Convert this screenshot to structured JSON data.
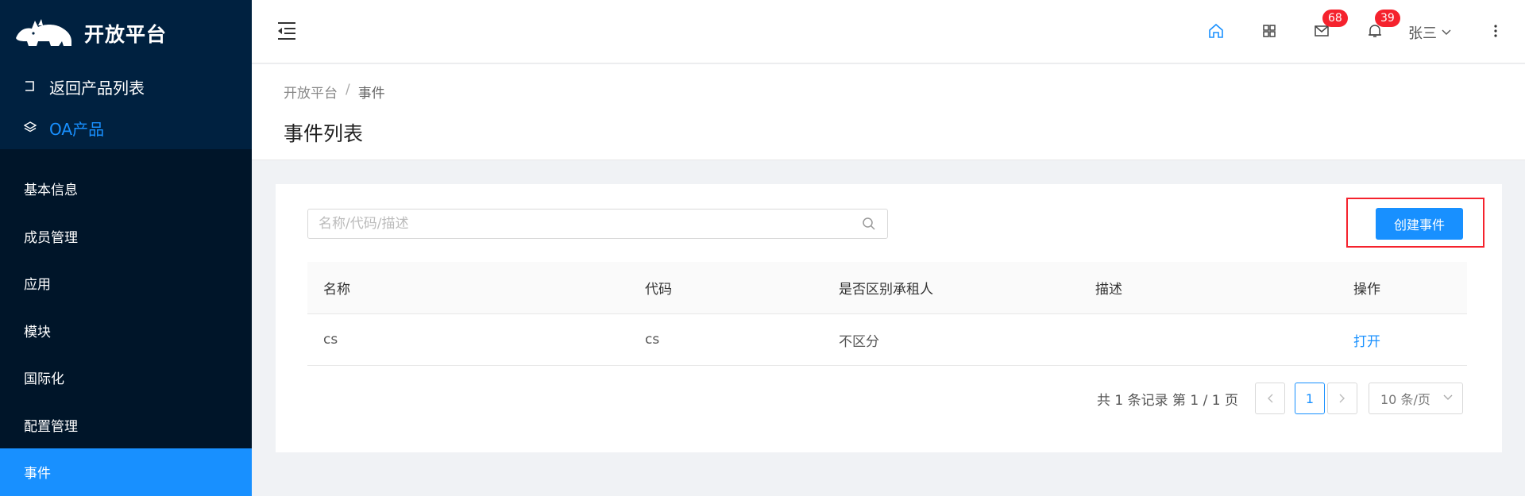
{
  "sidebar": {
    "logo_text": "开放平台",
    "back_label": "返回产品列表",
    "product_label": "OA产品",
    "items": [
      {
        "label": "基本信息"
      },
      {
        "label": "成员管理"
      },
      {
        "label": "应用"
      },
      {
        "label": "模块"
      },
      {
        "label": "国际化"
      },
      {
        "label": "配置管理"
      },
      {
        "label": "事件",
        "active": true
      }
    ]
  },
  "header": {
    "mail_badge": "68",
    "bell_badge": "39",
    "user_name": "张三",
    "icons": [
      "menu-fold-icon",
      "home-icon",
      "appstore-icon",
      "mail-icon",
      "bell-icon",
      "chevron-down-icon",
      "more-icon"
    ]
  },
  "page": {
    "breadcrumb": [
      "开放平台",
      "事件"
    ],
    "breadcrumb_sep": "/",
    "title": "事件列表"
  },
  "toolbar": {
    "search_placeholder": "名称/代码/描述",
    "create_label": "创建事件"
  },
  "table": {
    "columns": [
      "名称",
      "代码",
      "是否区别承租人",
      "描述",
      "操作"
    ],
    "rows": [
      {
        "name": "cs",
        "code": "cs",
        "distinguish": "不区分",
        "desc": "",
        "action": "打开"
      }
    ]
  },
  "pagination": {
    "info": "共 1 条记录 第 1 / 1 页",
    "current_page": "1",
    "page_size": "10 条/页"
  },
  "colors": {
    "sidebar_bg": "#001529",
    "accent": "#1890ff",
    "badge": "#f5222d"
  }
}
